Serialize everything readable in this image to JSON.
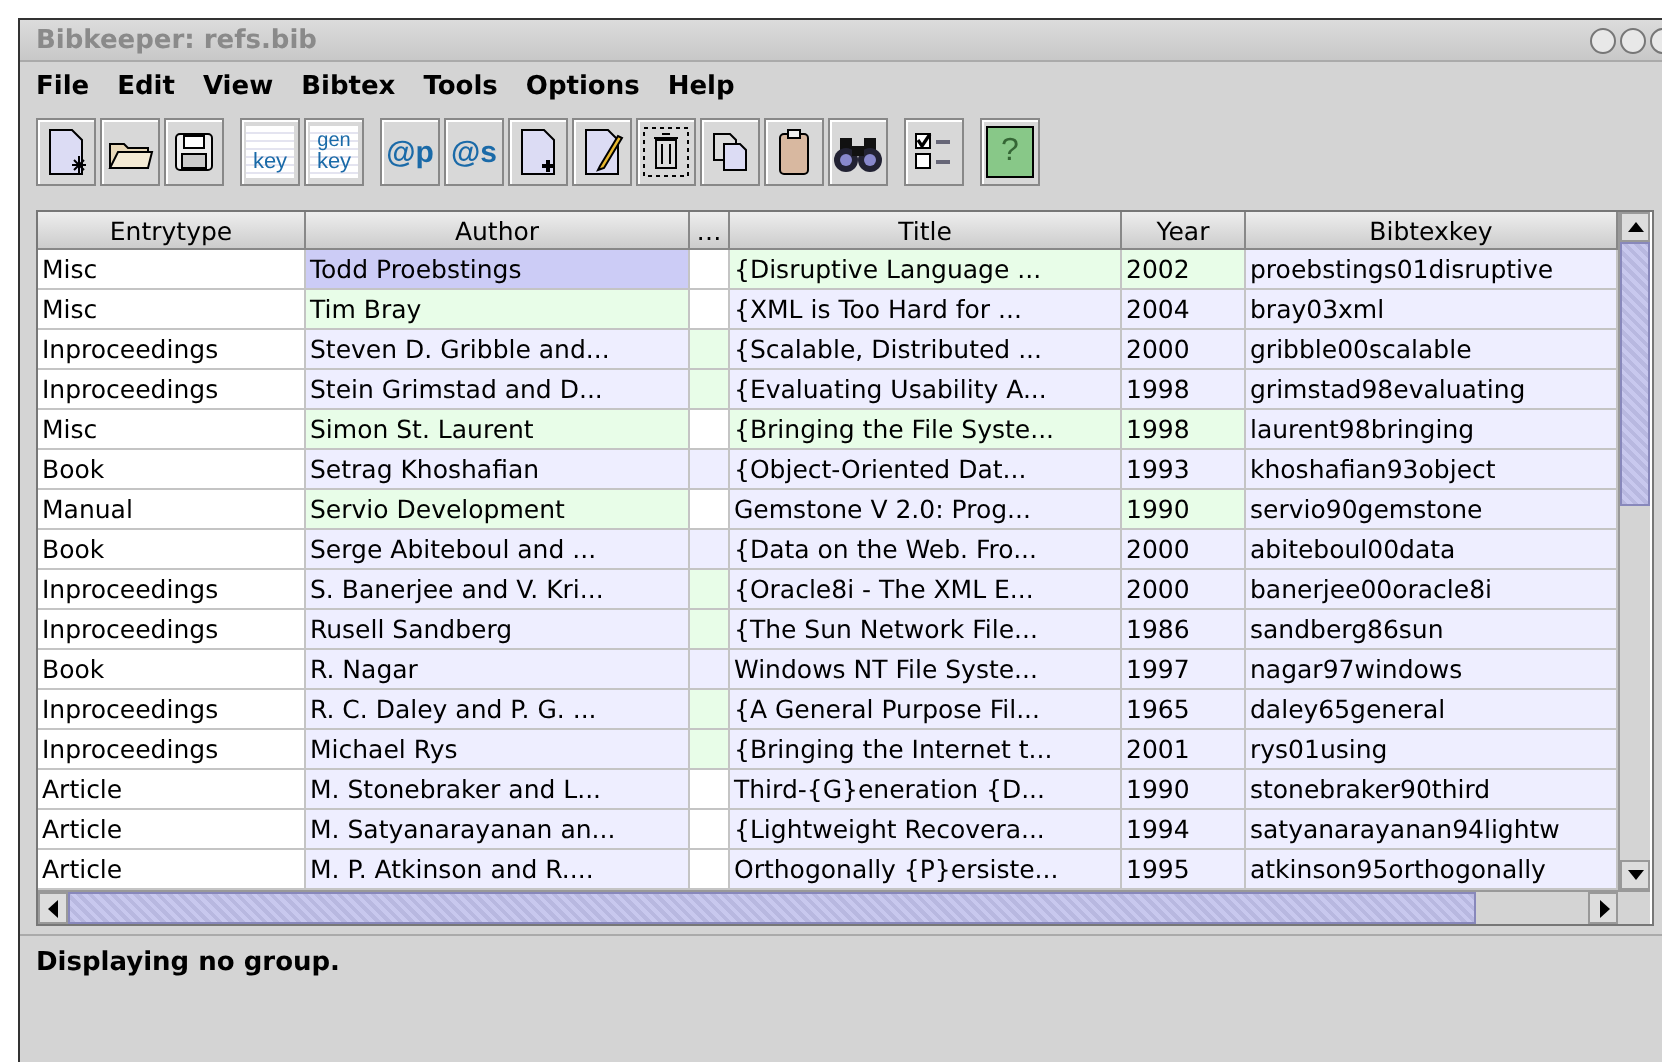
{
  "window": {
    "title": "Bibkeeper: refs.bib"
  },
  "menu": [
    "File",
    "Edit",
    "View",
    "Bibtex",
    "Tools",
    "Options",
    "Help"
  ],
  "toolbar": [
    [
      {
        "kind": "new-database"
      },
      {
        "kind": "open"
      },
      {
        "kind": "save"
      }
    ],
    [
      {
        "kind": "key",
        "label": "key"
      },
      {
        "kind": "genkey",
        "label": "gen",
        "label2": "key"
      }
    ],
    [
      {
        "kind": "at",
        "label": "@p"
      },
      {
        "kind": "at",
        "label": "@s"
      },
      {
        "kind": "new-entry"
      },
      {
        "kind": "edit"
      },
      {
        "kind": "delete"
      },
      {
        "kind": "copy"
      },
      {
        "kind": "paste"
      },
      {
        "kind": "search"
      }
    ],
    [
      {
        "kind": "groups"
      }
    ],
    [
      {
        "kind": "help",
        "label": "?"
      }
    ]
  ],
  "table": {
    "columns": [
      "Entrytype",
      "Author",
      "…",
      "Title",
      "Year",
      "Bibtexkey"
    ],
    "rows": [
      {
        "cells": [
          {
            "text": "Misc",
            "color": "#ffffff"
          },
          {
            "text": "Todd Proebstings",
            "color": "#ccccf6"
          },
          {
            "color": "#ffffff"
          },
          {
            "text": "{Disruptive Language ...",
            "color": "#e8fde8"
          },
          {
            "text": "2002",
            "color": "#e8fde8"
          },
          {
            "text": "proebstings01disruptive",
            "color": "#eeeeff"
          }
        ]
      },
      {
        "cells": [
          {
            "text": "Misc",
            "color": "#ffffff"
          },
          {
            "text": "Tim Bray",
            "color": "#e8fde8"
          },
          {
            "color": "#ffffff"
          },
          {
            "text": "{XML is Too Hard for ...",
            "color": "#eeeeff"
          },
          {
            "text": "2004",
            "color": "#eeeeff"
          },
          {
            "text": "bray03xml",
            "color": "#eeeeff"
          }
        ]
      },
      {
        "cells": [
          {
            "text": "Inproceedings",
            "color": "#ffffff"
          },
          {
            "text": "Steven D. Gribble and...",
            "color": "#eeeeff"
          },
          {
            "color": "#e8fde8"
          },
          {
            "text": "{Scalable, Distributed ...",
            "color": "#eeeeff"
          },
          {
            "text": "2000",
            "color": "#eeeeff"
          },
          {
            "text": "gribble00scalable",
            "color": "#eeeeff"
          }
        ]
      },
      {
        "cells": [
          {
            "text": "Inproceedings",
            "color": "#ffffff"
          },
          {
            "text": "Stein Grimstad and D...",
            "color": "#eeeeff"
          },
          {
            "color": "#e8fde8"
          },
          {
            "text": "{Evaluating Usability A...",
            "color": "#eeeeff"
          },
          {
            "text": "1998",
            "color": "#eeeeff"
          },
          {
            "text": "grimstad98evaluating",
            "color": "#eeeeff"
          }
        ]
      },
      {
        "cells": [
          {
            "text": "Misc",
            "color": "#ffffff"
          },
          {
            "text": "Simon St. Laurent",
            "color": "#e8fde8"
          },
          {
            "color": "#ffffff"
          },
          {
            "text": "{Bringing the File Syste...",
            "color": "#e8fde8"
          },
          {
            "text": "1998",
            "color": "#e8fde8"
          },
          {
            "text": "laurent98bringing",
            "color": "#eeeeff"
          }
        ]
      },
      {
        "cells": [
          {
            "text": "Book",
            "color": "#ffffff"
          },
          {
            "text": "Setrag Khoshafian",
            "color": "#eeeeff"
          },
          {
            "color": "#eeeeff"
          },
          {
            "text": "{Object-Oriented Dat...",
            "color": "#eeeeff"
          },
          {
            "text": "1993",
            "color": "#eeeeff"
          },
          {
            "text": "khoshafian93object",
            "color": "#eeeeff"
          }
        ]
      },
      {
        "cells": [
          {
            "text": "Manual",
            "color": "#ffffff"
          },
          {
            "text": "Servio Development",
            "color": "#e8fde8"
          },
          {
            "color": "#ffffff"
          },
          {
            "text": "Gemstone V 2.0: Prog...",
            "color": "#eeeeff"
          },
          {
            "text": "1990",
            "color": "#e8fde8"
          },
          {
            "text": "servio90gemstone",
            "color": "#eeeeff"
          }
        ]
      },
      {
        "cells": [
          {
            "text": "Book",
            "color": "#ffffff"
          },
          {
            "text": "Serge Abiteboul and ...",
            "color": "#eeeeff"
          },
          {
            "color": "#eeeeff"
          },
          {
            "text": "{Data on the Web. Fro...",
            "color": "#eeeeff"
          },
          {
            "text": "2000",
            "color": "#eeeeff"
          },
          {
            "text": "abiteboul00data",
            "color": "#eeeeff"
          }
        ]
      },
      {
        "cells": [
          {
            "text": "Inproceedings",
            "color": "#ffffff"
          },
          {
            "text": "S. Banerjee and V. Kri...",
            "color": "#eeeeff"
          },
          {
            "color": "#e8fde8"
          },
          {
            "text": "{Oracle8i - The XML E...",
            "color": "#eeeeff"
          },
          {
            "text": "2000",
            "color": "#eeeeff"
          },
          {
            "text": "banerjee00oracle8i",
            "color": "#eeeeff"
          }
        ]
      },
      {
        "cells": [
          {
            "text": "Inproceedings",
            "color": "#ffffff"
          },
          {
            "text": "Rusell Sandberg",
            "color": "#eeeeff"
          },
          {
            "color": "#e8fde8"
          },
          {
            "text": "{The Sun Network File...",
            "color": "#eeeeff"
          },
          {
            "text": "1986",
            "color": "#eeeeff"
          },
          {
            "text": "sandberg86sun",
            "color": "#eeeeff"
          }
        ]
      },
      {
        "cells": [
          {
            "text": "Book",
            "color": "#ffffff"
          },
          {
            "text": "R. Nagar",
            "color": "#eeeeff"
          },
          {
            "color": "#eeeeff"
          },
          {
            "text": "Windows NT File Syste...",
            "color": "#eeeeff"
          },
          {
            "text": "1997",
            "color": "#eeeeff"
          },
          {
            "text": "nagar97windows",
            "color": "#eeeeff"
          }
        ]
      },
      {
        "cells": [
          {
            "text": "Inproceedings",
            "color": "#ffffff"
          },
          {
            "text": "R. C. Daley and P. G. ...",
            "color": "#eeeeff"
          },
          {
            "color": "#e8fde8"
          },
          {
            "text": "{A General Purpose Fil...",
            "color": "#eeeeff"
          },
          {
            "text": "1965",
            "color": "#eeeeff"
          },
          {
            "text": "daley65general",
            "color": "#eeeeff"
          }
        ]
      },
      {
        "cells": [
          {
            "text": "Inproceedings",
            "color": "#ffffff"
          },
          {
            "text": "Michael Rys",
            "color": "#eeeeff"
          },
          {
            "color": "#e8fde8"
          },
          {
            "text": "{Bringing the Internet t...",
            "color": "#eeeeff"
          },
          {
            "text": "2001",
            "color": "#eeeeff"
          },
          {
            "text": "rys01using",
            "color": "#eeeeff"
          }
        ]
      },
      {
        "cells": [
          {
            "text": "Article",
            "color": "#ffffff"
          },
          {
            "text": "M. Stonebraker and L...",
            "color": "#eeeeff"
          },
          {
            "color": "#ffffff"
          },
          {
            "text": "Third-{G}eneration {D...",
            "color": "#eeeeff"
          },
          {
            "text": "1990",
            "color": "#eeeeff"
          },
          {
            "text": "stonebraker90third",
            "color": "#eeeeff"
          }
        ]
      },
      {
        "cells": [
          {
            "text": "Article",
            "color": "#ffffff"
          },
          {
            "text": "M. Satyanarayanan an...",
            "color": "#eeeeff"
          },
          {
            "color": "#ffffff"
          },
          {
            "text": "{Lightweight Recovera...",
            "color": "#eeeeff"
          },
          {
            "text": "1994",
            "color": "#eeeeff"
          },
          {
            "text": "satyanarayanan94lightw",
            "color": "#eeeeff"
          }
        ]
      },
      {
        "cells": [
          {
            "text": "Article",
            "color": "#ffffff"
          },
          {
            "text": "M. P. Atkinson and R....",
            "color": "#eeeeff"
          },
          {
            "color": "#ffffff"
          },
          {
            "text": "Orthogonally {P}ersiste...",
            "color": "#eeeeff"
          },
          {
            "text": "1995",
            "color": "#eeeeff"
          },
          {
            "text": "atkinson95orthogonally",
            "color": "#eeeeff"
          }
        ]
      }
    ]
  },
  "status_bar": "Displaying no group."
}
